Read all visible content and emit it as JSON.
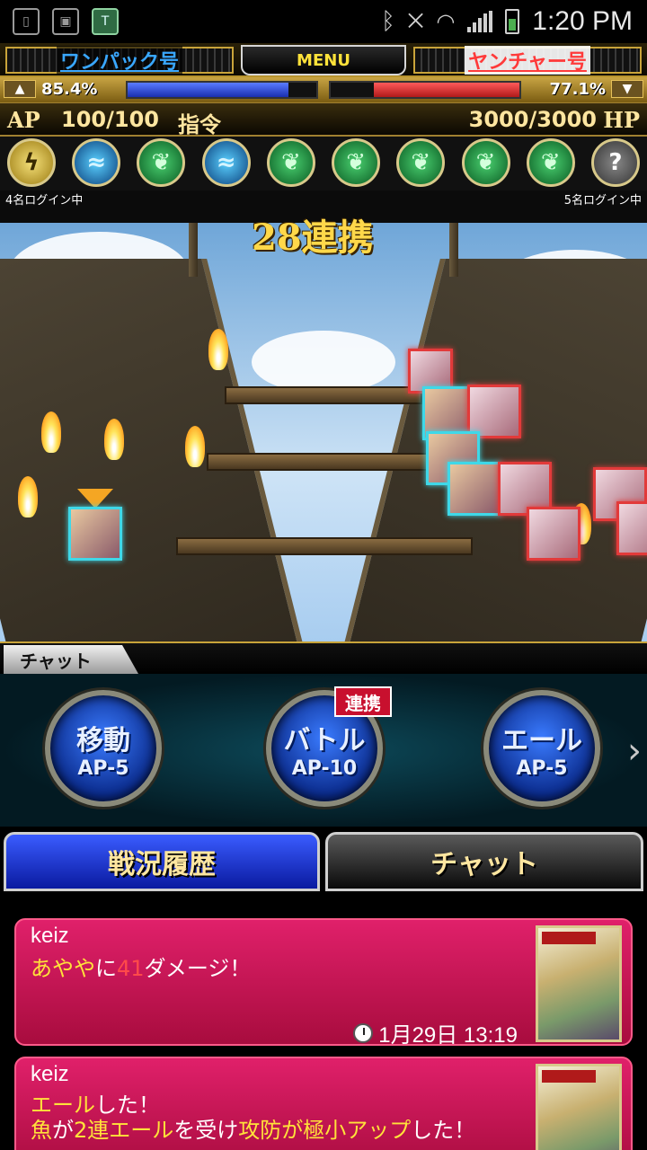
{
  "status_bar": {
    "time": "1:20 PM"
  },
  "header": {
    "team_left": "ワンパック号",
    "menu_label": "MENU",
    "team_right": "ヤンチャー号",
    "left_percent": "85.4%",
    "right_percent": "77.1%",
    "left_fill": 0.854,
    "right_fill": 0.771
  },
  "stats": {
    "ap_label": "AP",
    "ap_value": "100/100",
    "order_label": "指令",
    "hp_value": "3000/3000",
    "hp_label": "HP"
  },
  "skills": [
    {
      "icon": "lightning-icon",
      "glyph": "ϟ"
    },
    {
      "icon": "water-icon",
      "glyph": "≈"
    },
    {
      "icon": "leaf-icon",
      "glyph": "❦"
    },
    {
      "icon": "water-icon",
      "glyph": "≈"
    },
    {
      "icon": "leaf-icon",
      "glyph": "❦"
    },
    {
      "icon": "leaf-icon",
      "glyph": "❦"
    },
    {
      "icon": "leaf-icon",
      "glyph": "❦"
    },
    {
      "icon": "leaf-icon",
      "glyph": "❦"
    },
    {
      "icon": "leaf-icon",
      "glyph": "❦"
    },
    {
      "icon": "unknown-icon",
      "glyph": "?"
    }
  ],
  "logins": {
    "left": "4名ログイン中",
    "right": "5名ログイン中"
  },
  "battle": {
    "combo": "28連携"
  },
  "chat_strip_label": "チャット",
  "actions": {
    "move": {
      "title": "移動",
      "cost": "AP-5"
    },
    "battle": {
      "title": "バトル",
      "cost": "AP-10"
    },
    "cheer": {
      "title": "エール",
      "cost": "AP-5"
    },
    "link_badge": "連携"
  },
  "tabs": {
    "history": "戦況履歴",
    "chat": "チャット"
  },
  "log": [
    {
      "user": "keiz",
      "line1": {
        "a": "あやや",
        "b": "に",
        "c": "41",
        "d": "ダメージ！"
      },
      "time": "1月29日 13:19"
    },
    {
      "user": "keiz",
      "line1": {
        "a": "エール",
        "b": "した！"
      },
      "line2": {
        "a": "魚",
        "b": "が",
        "c": "2連エール",
        "d": "を受け",
        "e": "攻防が極小アップ",
        "f": "した！"
      }
    }
  ],
  "colors": {
    "accent_gold": "#c9a43a",
    "team_blue": "#39a7ff",
    "team_red": "#ff3a3a",
    "log_pink": "#e0206a"
  }
}
